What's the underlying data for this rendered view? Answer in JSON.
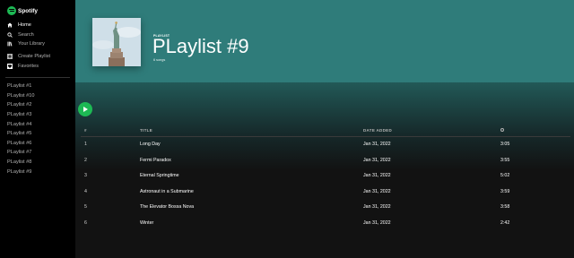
{
  "brand": {
    "name": "Spotify"
  },
  "nav": {
    "primary": [
      {
        "label": "Home",
        "icon": "home-icon"
      },
      {
        "label": "Search",
        "icon": "search-icon"
      },
      {
        "label": "Your Library",
        "icon": "library-icon"
      }
    ],
    "secondary": [
      {
        "label": "Create Playlist",
        "icon": "plus-icon"
      },
      {
        "label": "Favorites",
        "icon": "heart-icon"
      }
    ]
  },
  "playlists": [
    "PLaylist #1",
    "PLaylist #10",
    "PLaylist #2",
    "PLaylist #3",
    "PLaylist #4",
    "PLaylist #5",
    "PLaylist #6",
    "PLaylist #7",
    "PLaylist #8",
    "PLaylist #9"
  ],
  "header": {
    "type_label": "PLAYLIST",
    "title": "PLaylist #9",
    "song_count": "6 songs",
    "background_color": "#2f7c7a"
  },
  "table": {
    "columns": {
      "number": "#",
      "title": "TITLE",
      "date": "DATE ADDED",
      "duration_icon": "clock-icon"
    },
    "rows": [
      {
        "number": "1",
        "title": "Long Day",
        "date": "Jan 31, 2022",
        "duration": "3:05"
      },
      {
        "number": "2",
        "title": "Fermi Paradox",
        "date": "Jan 31, 2022",
        "duration": "3:55"
      },
      {
        "number": "3",
        "title": "Eternal Springtime",
        "date": "Jan 31, 2022",
        "duration": "5:02"
      },
      {
        "number": "4",
        "title": "Astronaut in a Submarine",
        "date": "Jan 31, 2022",
        "duration": "3:59"
      },
      {
        "number": "5",
        "title": "The Elevator Bossa Nova",
        "date": "Jan 31, 2022",
        "duration": "3:58"
      },
      {
        "number": "6",
        "title": "Winter",
        "date": "Jan 31, 2022",
        "duration": "2:42"
      }
    ]
  },
  "colors": {
    "accent": "#1db954",
    "sidebar": "#000000",
    "background": "#121212"
  }
}
